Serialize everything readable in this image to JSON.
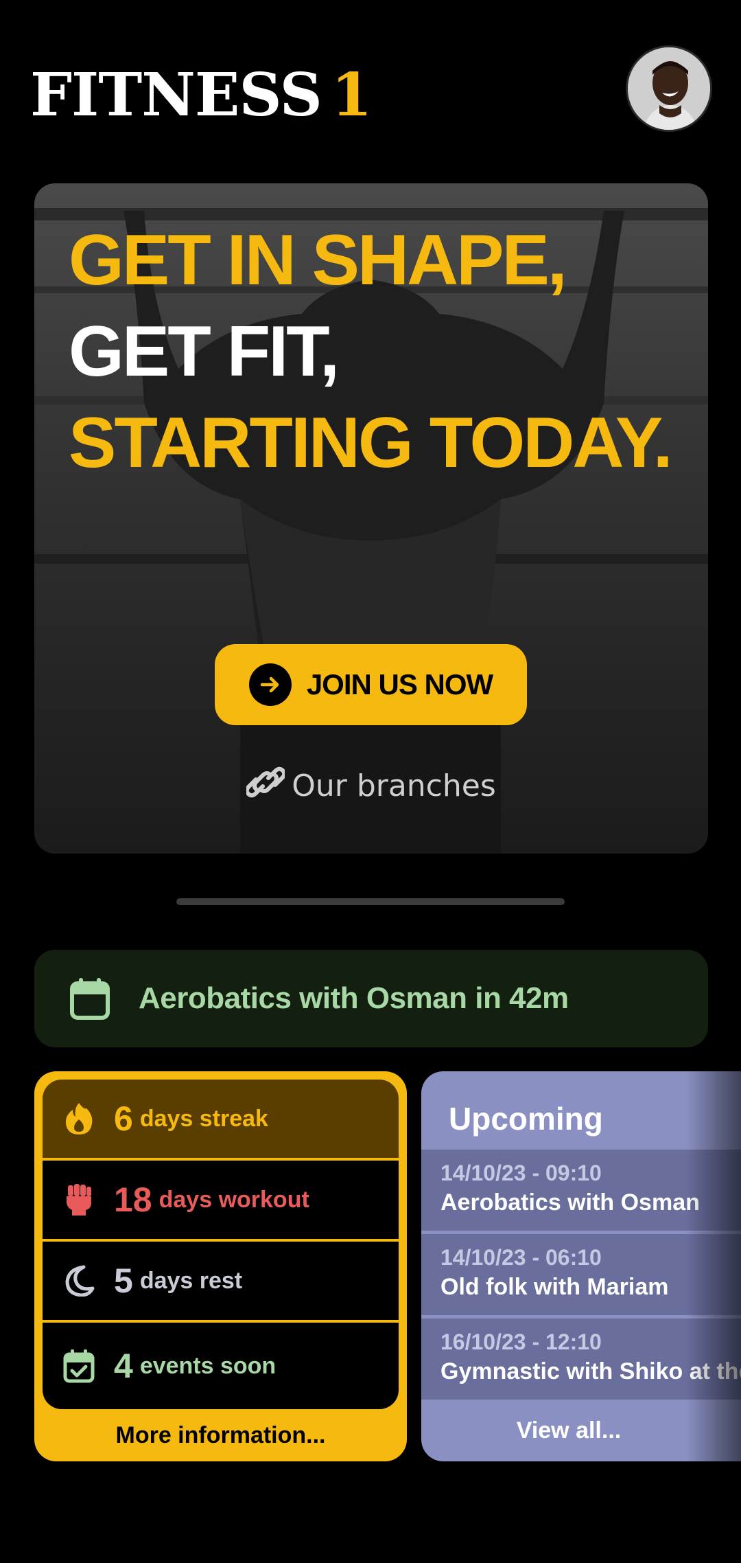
{
  "header": {
    "logo_text": "FITNESS",
    "logo_number": "1",
    "avatar_alt": "user-avatar"
  },
  "hero": {
    "line1": "GET IN SHAPE,",
    "line2": "GET FIT,",
    "line3": "STARTING TODAY.",
    "join_label": "JOIN US NOW",
    "branches_label": "Our branches"
  },
  "event_banner": {
    "text": "Aerobatics with Osman in 42m",
    "icon": "calendar-icon"
  },
  "stats": {
    "rows": [
      {
        "icon": "flame-icon",
        "number": "6",
        "label": "days streak",
        "color": "#f6b90f"
      },
      {
        "icon": "fist-icon",
        "number": "18",
        "label": "days workout",
        "color": "#e95b5b"
      },
      {
        "icon": "moon-icon",
        "number": "5",
        "label": "days rest",
        "color": "#c9ccd6"
      },
      {
        "icon": "calendar-check-icon",
        "number": "4",
        "label": "events soon",
        "color": "#a8d8a5"
      }
    ],
    "more_label": "More information..."
  },
  "upcoming": {
    "title": "Upcoming",
    "items": [
      {
        "date": "14/10/23 - 09:10",
        "name": "Aerobatics with Osman"
      },
      {
        "date": "14/10/23 - 06:10",
        "name": "Old folk with Mariam"
      },
      {
        "date": "16/10/23 - 12:10",
        "name": "Gymnastic with Shiko at the"
      }
    ],
    "view_all_label": "View all..."
  },
  "colors": {
    "accent": "#f6b90f",
    "background": "#000000",
    "upcoming_bg": "#8a91c2",
    "event_text": "#a8d8a5"
  }
}
